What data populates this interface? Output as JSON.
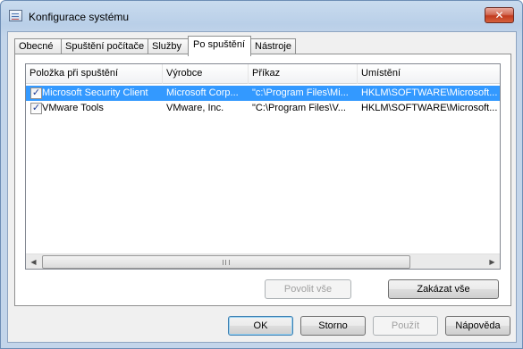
{
  "window": {
    "title": "Konfigurace systému",
    "close_symbol": "✕"
  },
  "tabs": [
    {
      "label": "Obecné",
      "active": false
    },
    {
      "label": "Spuštění počítače",
      "active": false
    },
    {
      "label": "Služby",
      "active": false
    },
    {
      "label": "Po spuštění",
      "active": true
    },
    {
      "label": "Nástroje",
      "active": false
    }
  ],
  "startup_list": {
    "columns": [
      "Položka při spuštění",
      "Výrobce",
      "Příkaz",
      "Umístění"
    ],
    "rows": [
      {
        "checked": true,
        "selected": true,
        "item": "Microsoft Security Client",
        "manufacturer": "Microsoft Corp...",
        "command": "\"c:\\Program Files\\Mi...",
        "location": "HKLM\\SOFTWARE\\Microsoft..."
      },
      {
        "checked": true,
        "selected": false,
        "item": "VMware Tools",
        "manufacturer": "VMware, Inc.",
        "command": "\"C:\\Program Files\\V...",
        "location": "HKLM\\SOFTWARE\\Microsoft..."
      }
    ],
    "scroll_left_icon": "◀",
    "scroll_right_icon": "▶"
  },
  "panel_buttons": {
    "enable_all": "Povolit vše",
    "disable_all": "Zakázat vše"
  },
  "dialog_buttons": {
    "ok": "OK",
    "cancel": "Storno",
    "apply": "Použít",
    "help": "Nápověda"
  },
  "colors": {
    "selection": "#3399ff",
    "title_gradient_top": "#c9dbee",
    "close_button": "#c23a1e"
  }
}
